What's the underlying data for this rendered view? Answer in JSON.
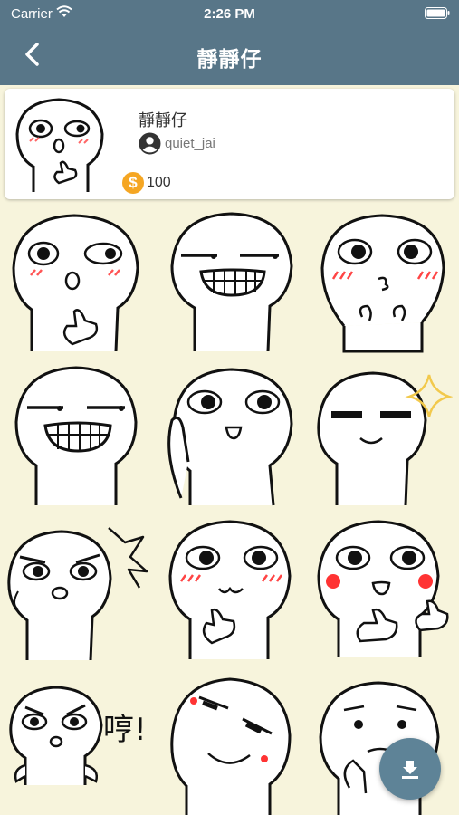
{
  "status_bar": {
    "carrier": "Carrier",
    "time": "2:26 PM"
  },
  "header": {
    "title": "靜靜仔",
    "back_icon": "chevron-left-icon"
  },
  "pack": {
    "name": "靜靜仔",
    "username": "quiet_jai",
    "coins": "100",
    "coin_icon": "dollar-coin-icon",
    "user_icon": "user-circle-icon"
  },
  "stickers": {
    "count": 12,
    "label_exclaim": "哼!"
  },
  "download_button": {
    "icon": "download-icon"
  },
  "colors": {
    "header": "#587688",
    "background": "#f7f4dc",
    "coin": "#f5a623",
    "fab": "#5e8397"
  }
}
